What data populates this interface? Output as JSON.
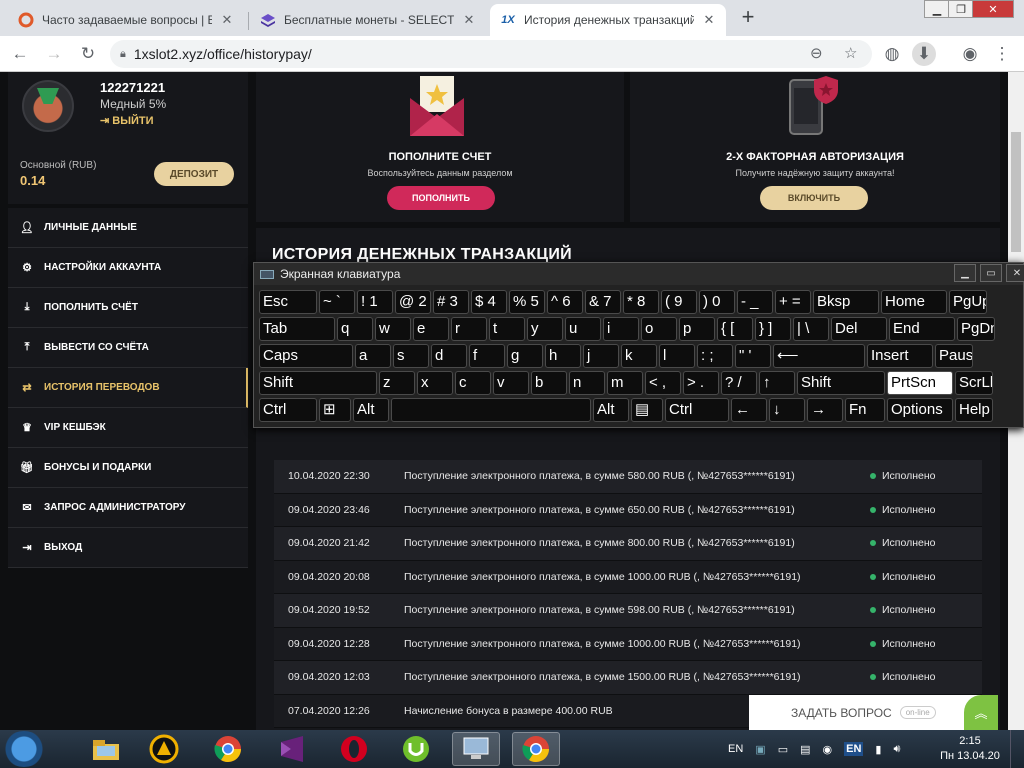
{
  "browser": {
    "tabs": [
      {
        "title": "Часто задаваемые вопросы | Вы",
        "active": false
      },
      {
        "title": "Бесплатные монеты - SELECTOR",
        "active": false
      },
      {
        "title": "История денежных транзакций",
        "active": true
      }
    ],
    "url": "1xslot2.xyz/office/historypay/"
  },
  "profile": {
    "user_id": "122271221",
    "level": "Медный 5%",
    "logout": "ВЫЙТИ",
    "balance_label": "Основной (RUB)",
    "balance_value": "0.14",
    "deposit_button": "ДЕПОЗИТ"
  },
  "menu": [
    {
      "label": "ЛИЧНЫЕ ДАННЫЕ",
      "icon": "user-plus-icon"
    },
    {
      "label": "НАСТРОЙКИ АККАУНТА",
      "icon": "gears-icon"
    },
    {
      "label": "ПОПОЛНИТЬ СЧЁТ",
      "icon": "download-icon"
    },
    {
      "label": "ВЫВЕСТИ СО СЧЁТА",
      "icon": "upload-icon"
    },
    {
      "label": "ИСТОРИЯ ПЕРЕВОДОВ",
      "icon": "transfer-arrows-icon",
      "active": true
    },
    {
      "label": "VIP КЕШБЭК",
      "icon": "crown-icon"
    },
    {
      "label": "БОНУСЫ И ПОДАРКИ",
      "icon": "gift-icon"
    },
    {
      "label": "ЗАПРОС АДМИНИСТРАТОРУ",
      "icon": "envelope-icon"
    },
    {
      "label": "ВЫХОД",
      "icon": "exit-icon"
    }
  ],
  "promo_deposit": {
    "title": "ПОПОЛНИТЕ СЧЕТ",
    "subtitle": "Воспользуйтесь данным разделом",
    "button": "ПОПОЛНИТЬ",
    "icon": "envelope-star-icon"
  },
  "promo_2fa": {
    "title": "2-Х ФАКТОРНАЯ АВТОРИЗАЦИЯ",
    "subtitle": "Получите надёжную защиту аккаунта!",
    "button": "ВКЛЮЧИТЬ",
    "icon": "phone-shield-icon"
  },
  "history": {
    "title": "ИСТОРИЯ ДЕНЕЖНЫХ ТРАНЗАКЦИЙ",
    "rows": [
      {
        "date": "10.04.2020 22:30",
        "desc": "Поступление электронного платежа, в сумме 580.00 RUB (, №427653******6191)",
        "status": "Исполнено"
      },
      {
        "date": "09.04.2020 23:46",
        "desc": "Поступление электронного платежа, в сумме 650.00 RUB (, №427653******6191)",
        "status": "Исполнено"
      },
      {
        "date": "09.04.2020 21:42",
        "desc": "Поступление электронного платежа, в сумме 800.00 RUB (, №427653******6191)",
        "status": "Исполнено"
      },
      {
        "date": "09.04.2020 20:08",
        "desc": "Поступление электронного платежа, в сумме 1000.00 RUB (, №427653******6191)",
        "status": "Исполнено"
      },
      {
        "date": "09.04.2020 19:52",
        "desc": "Поступление электронного платежа, в сумме 598.00 RUB (, №427653******6191)",
        "status": "Исполнено"
      },
      {
        "date": "09.04.2020 12:28",
        "desc": "Поступление электронного платежа, в сумме 1000.00 RUB (, №427653******6191)",
        "status": "Исполнено"
      },
      {
        "date": "09.04.2020 12:03",
        "desc": "Поступление электронного платежа, в сумме 1500.00 RUB (, №427653******6191)",
        "status": "Исполнено"
      },
      {
        "date": "07.04.2020 12:26",
        "desc": "Начисление бонуса в размере 400.00 RUB",
        "status": ""
      }
    ]
  },
  "ask_widget": {
    "label": "ЗАДАТЬ ВОПРОС",
    "status": "on-line"
  },
  "osk": {
    "title": "Экранная клавиатура",
    "rows": [
      [
        [
          "Esc",
          ""
        ],
        [
          "~ `",
          ""
        ],
        [
          "! 1",
          ""
        ],
        [
          "@ 2",
          ""
        ],
        [
          "# 3",
          ""
        ],
        [
          "$ 4",
          ""
        ],
        [
          "% 5",
          ""
        ],
        [
          "^ 6",
          ""
        ],
        [
          "& 7",
          ""
        ],
        [
          "* 8",
          ""
        ],
        [
          "( 9",
          ""
        ],
        [
          ") 0",
          ""
        ],
        [
          "- _",
          ""
        ],
        [
          "+ =",
          ""
        ],
        [
          "Bksp",
          ""
        ],
        [
          "Home",
          ""
        ],
        [
          "PgUp",
          ""
        ]
      ],
      [
        [
          "Tab",
          ""
        ],
        [
          "q",
          ""
        ],
        [
          "w",
          ""
        ],
        [
          "e",
          ""
        ],
        [
          "r",
          ""
        ],
        [
          "t",
          ""
        ],
        [
          "y",
          ""
        ],
        [
          "u",
          ""
        ],
        [
          "i",
          ""
        ],
        [
          "o",
          ""
        ],
        [
          "p",
          ""
        ],
        [
          "{ [",
          ""
        ],
        [
          "} ]",
          ""
        ],
        [
          "| \\",
          ""
        ],
        [
          "Del",
          ""
        ],
        [
          "End",
          ""
        ],
        [
          "PgDn",
          ""
        ]
      ],
      [
        [
          "Caps",
          ""
        ],
        [
          "a",
          ""
        ],
        [
          "s",
          ""
        ],
        [
          "d",
          ""
        ],
        [
          "f",
          ""
        ],
        [
          "g",
          ""
        ],
        [
          "h",
          ""
        ],
        [
          "j",
          ""
        ],
        [
          "k",
          ""
        ],
        [
          "l",
          ""
        ],
        [
          ": ;",
          ""
        ],
        [
          "\" '",
          ""
        ],
        [
          "⟵",
          ""
        ],
        [
          "Insert",
          ""
        ],
        [
          "Pause",
          ""
        ]
      ],
      [
        [
          "Shift",
          ""
        ],
        [
          "z",
          ""
        ],
        [
          "x",
          ""
        ],
        [
          "c",
          ""
        ],
        [
          "v",
          ""
        ],
        [
          "b",
          ""
        ],
        [
          "n",
          ""
        ],
        [
          "m",
          ""
        ],
        [
          "< ,",
          ""
        ],
        [
          "> .",
          ""
        ],
        [
          "? /",
          ""
        ],
        [
          "↑",
          ""
        ],
        [
          "Shift",
          ""
        ],
        [
          "PrtScn",
          "hl"
        ],
        [
          "ScrLk",
          ""
        ]
      ],
      [
        [
          "Ctrl",
          ""
        ],
        [
          "⊞",
          ""
        ],
        [
          "Alt",
          ""
        ],
        [
          "",
          ""
        ],
        [
          "Alt",
          ""
        ],
        [
          "▤",
          ""
        ],
        [
          "Ctrl",
          ""
        ],
        [
          "←",
          ""
        ],
        [
          "↓",
          ""
        ],
        [
          "→",
          ""
        ],
        [
          "Fn",
          ""
        ],
        [
          "Options",
          ""
        ],
        [
          "Help",
          ""
        ]
      ]
    ]
  },
  "taskbar": {
    "apps": [
      "file-explorer-icon",
      "aimp-icon",
      "chrome-icon",
      "visual-studio-icon",
      "opera-icon",
      "utorrent-icon",
      "remote-desktop-icon",
      "chrome-active-icon"
    ],
    "lang": "EN",
    "tray_lang": "EN",
    "time": "2:15",
    "date": "Пн 13.04.20"
  }
}
